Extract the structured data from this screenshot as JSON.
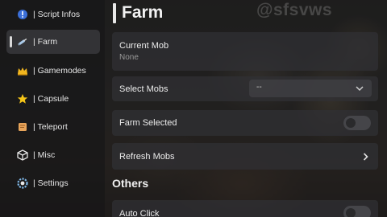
{
  "watermark": "@sfsvws",
  "sidebar": {
    "items": [
      {
        "label": "| Script Infos",
        "icon": "info-icon"
      },
      {
        "label": "| Farm",
        "icon": "syringe-icon",
        "active": true
      },
      {
        "label": "| Gamemodes",
        "icon": "crown-icon"
      },
      {
        "label": "| Capsule",
        "icon": "star-icon"
      },
      {
        "label": "| Teleport",
        "icon": "scroll-icon"
      },
      {
        "label": "| Misc",
        "icon": "cube-icon"
      },
      {
        "label": "| Settings",
        "icon": "gear-icon"
      }
    ]
  },
  "page": {
    "title": "Farm",
    "current_mob": {
      "label": "Current Mob",
      "value": "None"
    },
    "select_mobs": {
      "label": "Select Mobs",
      "value": "--"
    },
    "farm_selected": {
      "label": "Farm Selected",
      "enabled": false
    },
    "refresh_mobs": {
      "label": "Refresh Mobs"
    },
    "others_title": "Others",
    "auto_click": {
      "label": "Auto Click",
      "enabled": false
    }
  },
  "colors": {
    "panel": "#303034",
    "accent_text": "#f2f2f2",
    "muted_text": "#9a9a9a"
  }
}
